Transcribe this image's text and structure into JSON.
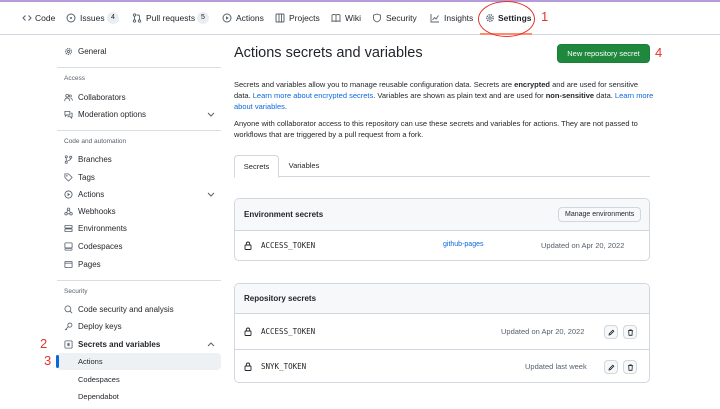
{
  "repo_nav": {
    "tabs": [
      {
        "label": "Code",
        "count": null
      },
      {
        "label": "Issues",
        "count": "4"
      },
      {
        "label": "Pull requests",
        "count": "5"
      },
      {
        "label": "Actions",
        "count": null
      },
      {
        "label": "Projects",
        "count": null
      },
      {
        "label": "Wiki",
        "count": null
      },
      {
        "label": "Security",
        "count": null
      },
      {
        "label": "Insights",
        "count": null
      },
      {
        "label": "Settings",
        "count": null
      }
    ],
    "selected": "Settings"
  },
  "annotations": {
    "settings": "1",
    "secrets_and_variables": "2",
    "actions": "3",
    "new_secret": "4",
    "color": "#e0352b"
  },
  "sidebar": {
    "general": "General",
    "access_heading": "Access",
    "collaborators": "Collaborators",
    "moderation_options": "Moderation options",
    "code_automation_heading": "Code and automation",
    "branches": "Branches",
    "tags": "Tags",
    "actions": "Actions",
    "webhooks": "Webhooks",
    "environments": "Environments",
    "codespaces": "Codespaces",
    "pages": "Pages",
    "security_heading": "Security",
    "code_security": "Code security and analysis",
    "deploy_keys": "Deploy keys",
    "secrets_and_variables": "Secrets and variables",
    "sub_actions": "Actions",
    "sub_codespaces": "Codespaces",
    "sub_dependabot": "Dependabot"
  },
  "main": {
    "title": "Actions secrets and variables",
    "new_secret_button": "New repository secret",
    "intro": {
      "p1_a": "Secrets and variables allow you to manage reusable configuration data. Secrets are ",
      "p1_b": "encrypted",
      "p1_c": " and are used for sensitive data. ",
      "p1_link1": "Learn more about encrypted secrets",
      "p1_d": ". Variables are shown as plain text and are used for ",
      "p1_e": "non-sensitive",
      "p1_f": " data. ",
      "p1_link2": "Learn more about variables",
      "p1_g": ".",
      "p2": "Anyone with collaborator access to this repository can use these secrets and variables for actions. They are not passed to workflows that are triggered by a pull request from a fork."
    },
    "tabs": {
      "secrets": "Secrets",
      "variables": "Variables"
    },
    "environment_secrets": {
      "title": "Environment secrets",
      "manage_button": "Manage environments",
      "rows": [
        {
          "name": "ACCESS_TOKEN",
          "environment": "github-pages",
          "updated": "Updated on Apr 20, 2022"
        }
      ]
    },
    "repository_secrets": {
      "title": "Repository secrets",
      "rows": [
        {
          "name": "ACCESS_TOKEN",
          "updated": "Updated on Apr 20, 2022"
        },
        {
          "name": "SNYK_TOKEN",
          "updated": "Updated last week"
        }
      ]
    }
  },
  "colors": {
    "link": "#0969da",
    "primary_button": "#1f883d",
    "nav_underline": "#fd8c73"
  }
}
